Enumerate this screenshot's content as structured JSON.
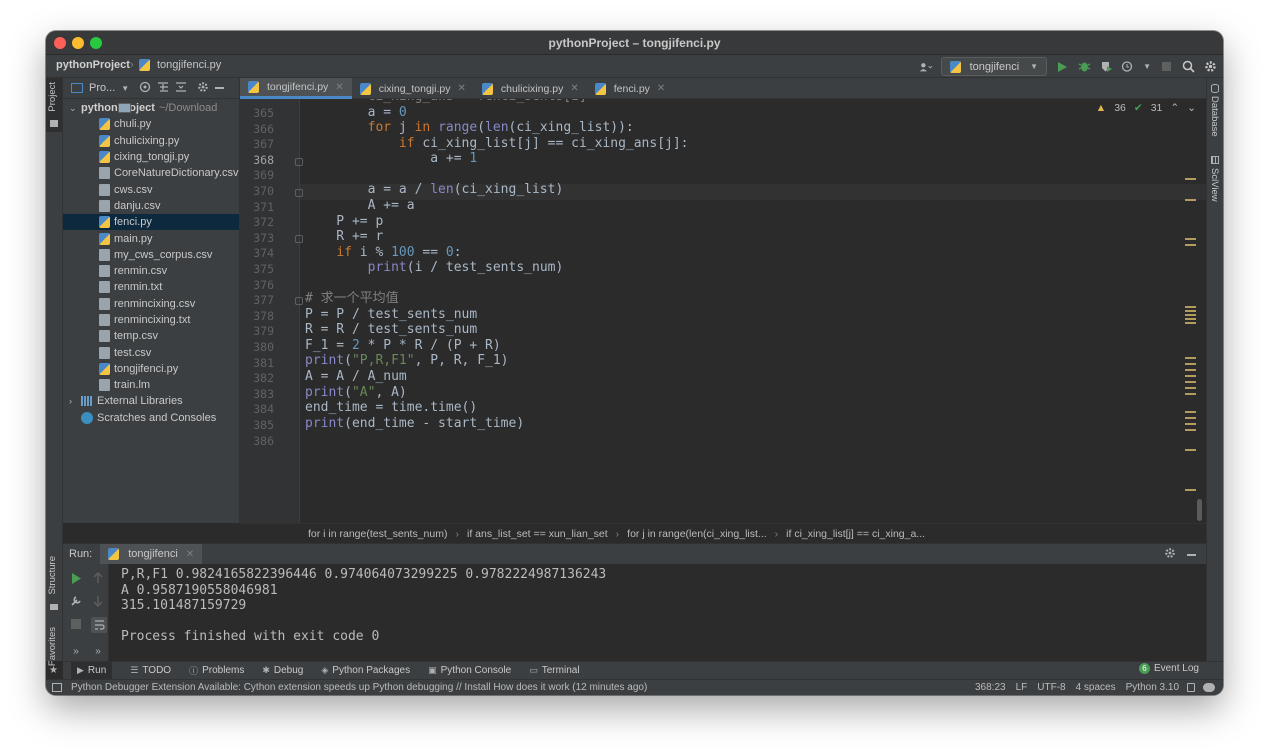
{
  "window": {
    "title": "pythonProject – tongjifenci.py"
  },
  "navbar": {
    "project": "pythonProject",
    "file": "tongjifenci.py",
    "run_config": "tongjifenci"
  },
  "left_strip": {
    "project": "Project",
    "structure": "Structure",
    "favorites": "Favorites"
  },
  "right_strip": {
    "database": "Database",
    "sciview": "SciView"
  },
  "project_panel": {
    "header": "Pro...",
    "root": "pythonProject",
    "root_path": "~/Download",
    "files": [
      {
        "name": "chuli.py",
        "type": "py"
      },
      {
        "name": "chulicixing.py",
        "type": "py"
      },
      {
        "name": "cixing_tongji.py",
        "type": "py"
      },
      {
        "name": "CoreNatureDictionary.csv",
        "type": "txt"
      },
      {
        "name": "cws.csv",
        "type": "txt"
      },
      {
        "name": "danju.csv",
        "type": "txt"
      },
      {
        "name": "fenci.py",
        "type": "py"
      },
      {
        "name": "main.py",
        "type": "py"
      },
      {
        "name": "my_cws_corpus.csv",
        "type": "txt"
      },
      {
        "name": "renmin.csv",
        "type": "txt"
      },
      {
        "name": "renmin.txt",
        "type": "txt"
      },
      {
        "name": "renmincixing.csv",
        "type": "txt"
      },
      {
        "name": "renmincixing.txt",
        "type": "txt"
      },
      {
        "name": "temp.csv",
        "type": "txt"
      },
      {
        "name": "test.csv",
        "type": "txt"
      },
      {
        "name": "tongjifenci.py",
        "type": "py"
      },
      {
        "name": "train.lm",
        "type": "txt"
      }
    ],
    "external": "External Libraries",
    "scratches": "Scratches and Consoles"
  },
  "tabs": [
    {
      "label": "tongjifenci.py",
      "active": true
    },
    {
      "label": "cixing_tongji.py",
      "active": false
    },
    {
      "label": "chulicixing.py",
      "active": false
    },
    {
      "label": "fenci.py",
      "active": false
    }
  ],
  "inspections": {
    "warnings": "36",
    "ok": "31"
  },
  "editor": {
    "line_numbers": [
      "365",
      "366",
      "367",
      "368",
      "369",
      "370",
      "371",
      "372",
      "373",
      "374",
      "375",
      "376",
      "377",
      "378",
      "379",
      "380",
      "381",
      "382",
      "383",
      "384",
      "385",
      "386"
    ],
    "current_line": "368"
  },
  "breadcrumbs": [
    "for i in range(test_sents_num)",
    "if ans_list_set == xun_lian_set",
    "for j in range(len(ci_xing_list...",
    "if ci_xing_list[j] == ci_xing_a..."
  ],
  "run": {
    "label": "Run:",
    "tab": "tongjifenci",
    "output": [
      "P,R,F1 0.9824165822396446 0.974064073299225 0.9782224987136243",
      "A 0.9587190558046981",
      "315.101487159729",
      "",
      "Process finished with exit code 0"
    ]
  },
  "toolwindows": [
    "Run",
    "TODO",
    "Problems",
    "Debug",
    "Python Packages",
    "Python Console",
    "Terminal"
  ],
  "event_log": {
    "count": "6",
    "label": "Event Log"
  },
  "status": {
    "message": "Python Debugger Extension Available: Cython extension speeds up Python debugging // Install   How does it work (12 minutes ago)",
    "position": "368:23",
    "line_sep": "LF",
    "encoding": "UTF-8",
    "indent": "4 spaces",
    "interpreter": "Python 3.10"
  }
}
